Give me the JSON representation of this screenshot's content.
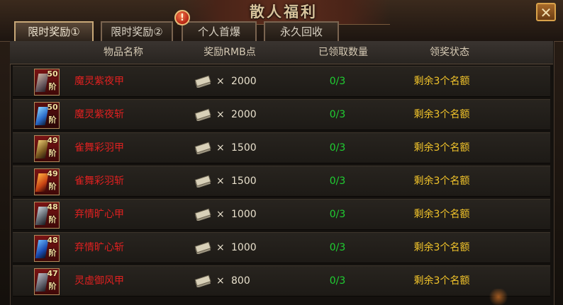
{
  "window": {
    "title": "散人福利",
    "close_label": "✕",
    "alert_badge": "!"
  },
  "tabs": [
    {
      "label": "限时奖励①",
      "active": true
    },
    {
      "label": "限时奖励②",
      "active": false
    },
    {
      "label": "个人首爆",
      "active": false
    },
    {
      "label": "永久回收",
      "active": false
    }
  ],
  "table": {
    "headers": {
      "item_name": "物品名称",
      "reward": "奖励RMB点",
      "claimed": "已领取数量",
      "status": "领奖状态"
    },
    "times_symbol": "×",
    "level_unit": "阶",
    "rows": [
      {
        "name": "魔灵紫夜甲",
        "level": "50",
        "amount": "2000",
        "claimed": "0/3",
        "status": "剩余3个名额"
      },
      {
        "name": "魔灵紫夜斩",
        "level": "50",
        "amount": "2000",
        "claimed": "0/3",
        "status": "剩余3个名额"
      },
      {
        "name": "雀舞彩羽甲",
        "level": "49",
        "amount": "1500",
        "claimed": "0/3",
        "status": "剩余3个名额"
      },
      {
        "name": "雀舞彩羽斩",
        "level": "49",
        "amount": "1500",
        "claimed": "0/3",
        "status": "剩余3个名额"
      },
      {
        "name": "弃情旷心甲",
        "level": "48",
        "amount": "1000",
        "claimed": "0/3",
        "status": "剩余3个名额"
      },
      {
        "name": "弃情旷心斩",
        "level": "48",
        "amount": "1000",
        "claimed": "0/3",
        "status": "剩余3个名额"
      },
      {
        "name": "灵虚御风甲",
        "level": "47",
        "amount": "800",
        "claimed": "0/3",
        "status": "剩余3个名额"
      }
    ]
  },
  "colors": {
    "item_name": "#e02020",
    "claimed": "#1fcf32",
    "status": "#f2c42a"
  },
  "icons": {
    "close": "close-icon",
    "alert": "alert-icon",
    "currency": "banknote-icon",
    "item": "equipment-icon"
  }
}
